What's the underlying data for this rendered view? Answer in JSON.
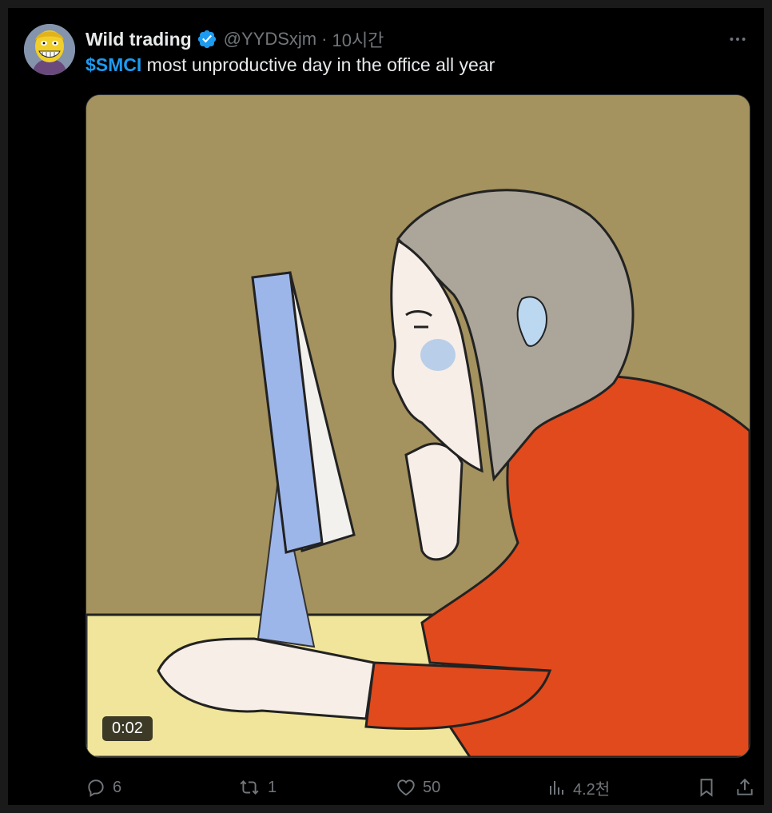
{
  "tweet": {
    "author_name": "Wild trading",
    "handle": "@YYDSxjm",
    "separator": "·",
    "time": "10시간",
    "cashtag": "$SMCI",
    "text": " most unproductive day in the office all year",
    "video_duration": "0:02",
    "icons": {
      "verified": "verified-badge-icon",
      "more": "more-icon",
      "reply": "reply-icon",
      "repost": "repost-icon",
      "like": "like-icon",
      "views": "views-icon",
      "bookmark": "bookmark-icon",
      "share": "share-icon"
    }
  },
  "stats": {
    "replies": "6",
    "reposts": "1",
    "likes": "50",
    "views": "4.2천"
  },
  "colors": {
    "background": "#000000",
    "primary_text": "#e7e9ea",
    "secondary_text": "#71767b",
    "accent": "#1d9bf0",
    "video_background": "#a4925f",
    "sweater": "#e04a1c",
    "desk": "#f0e59a",
    "monitor": "#9db6ea"
  }
}
